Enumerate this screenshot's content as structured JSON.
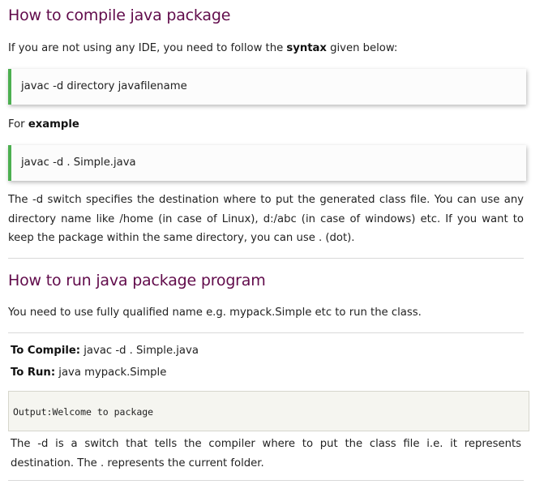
{
  "section1": {
    "heading": "How to compile java package",
    "intro_before": "If you are not using any IDE, you need to follow the ",
    "intro_bold": "syntax",
    "intro_after": " given below:",
    "syntax_code": "javac -d directory javafilename",
    "example_before": "For ",
    "example_bold": "example",
    "example_code": "javac -d . Simple.java",
    "explanation": "The -d switch specifies the destination where to put the generated class file. You can use any directory name like /home (in case of Linux), d:/abc (in case of windows) etc. If you want to keep the package within the same directory, you can use . (dot)."
  },
  "section2": {
    "heading": "How to run java package program",
    "intro": "You need to use fully qualified name e.g. mypack.Simple etc to run the class.",
    "compile_label": "To Compile:",
    "compile_cmd": " javac -d . Simple.java",
    "run_label": "To Run:",
    "run_cmd": " java mypack.Simple",
    "output": "Output:Welcome to package",
    "note": "The -d is a switch that tells the compiler where to put the class file i.e. it represents destination. The . represents the current folder."
  }
}
